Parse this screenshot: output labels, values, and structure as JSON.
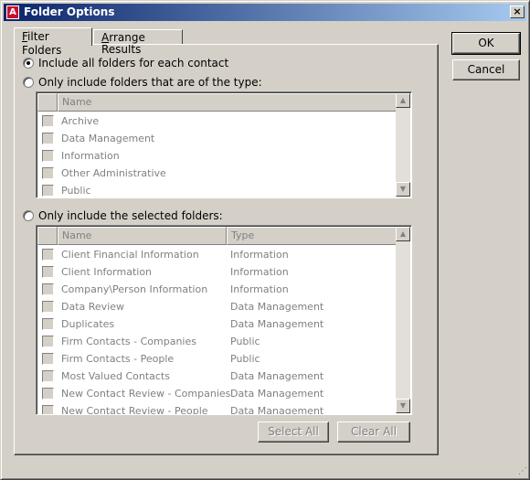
{
  "window": {
    "title": "Folder Options",
    "icon": "app-logo-icon",
    "close_glyph": "×"
  },
  "buttons": {
    "ok": "OK",
    "cancel": "Cancel",
    "select_all": "Select All",
    "clear_all": "Clear All"
  },
  "tabs": [
    {
      "label_first": "F",
      "label_rest": "ilter Folders",
      "active": true
    },
    {
      "label_first": "A",
      "label_rest": "rrange Results",
      "active": false
    }
  ],
  "options": {
    "all": "Include all folders for each contact",
    "type": "Only include folders that are of the type:",
    "selected": "Only include the selected folders:",
    "checked": "all"
  },
  "type_list": {
    "header": "Name",
    "items": [
      "Archive",
      "Data Management",
      "Information",
      "Other Administrative",
      "Public"
    ]
  },
  "folder_list": {
    "headers": [
      "Name",
      "Type"
    ],
    "rows": [
      [
        "Client Financial Information",
        "Information"
      ],
      [
        "Client Information",
        "Information"
      ],
      [
        "Company\\Person Information",
        "Information"
      ],
      [
        "Data Review",
        "Data Management"
      ],
      [
        "Duplicates",
        "Data Management"
      ],
      [
        "Firm Contacts - Companies",
        "Public"
      ],
      [
        "Firm Contacts - People",
        "Public"
      ],
      [
        "Most Valued Contacts",
        "Data Management"
      ],
      [
        "New Contact Review - Companies",
        "Data Management"
      ],
      [
        "New Contact Review - People",
        "Data Management"
      ]
    ]
  },
  "scroll": {
    "up": "▲",
    "down": "▼"
  }
}
